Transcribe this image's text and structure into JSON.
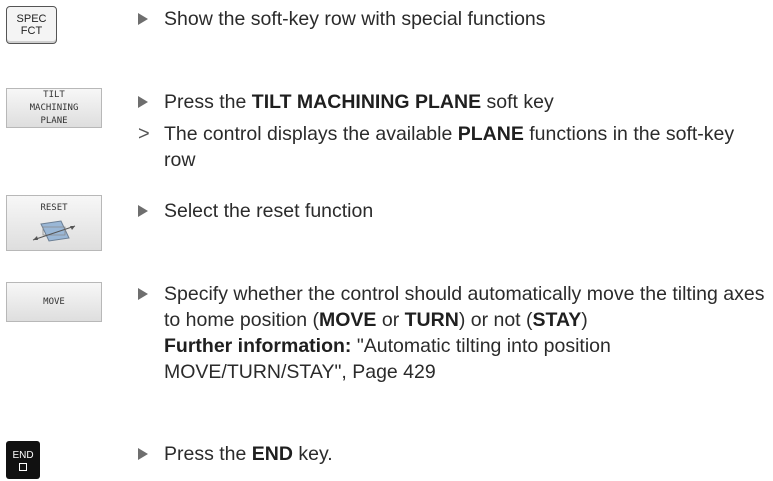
{
  "keys": {
    "spec_fct": "SPEC\nFCT",
    "tilt": "TILT\nMACHINING\nPLANE",
    "reset": "RESET",
    "move": "MOVE",
    "end": "END"
  },
  "steps": {
    "s1": "Show the soft-key row with special functions",
    "s2_pre": "Press the ",
    "s2_bold": "TILT MACHINING PLANE",
    "s2_post": " soft key",
    "s3_pre": "The control displays the available ",
    "s3_bold": "PLANE",
    "s3_post": " functions in the soft-key row",
    "s4": "Select the reset function",
    "s5_a": "Specify whether the control should automatically move the tilting axes to home position (",
    "s5_move": "MOVE",
    "s5_or": " or ",
    "s5_turn": "TURN",
    "s5_b": ") or not (",
    "s5_stay": "STAY",
    "s5_c": ")",
    "s5_info_label": "Further information:",
    "s5_info_text": " \"Automatic tilting into position MOVE/TURN/STAY\", Page 429",
    "s6_pre": "Press the ",
    "s6_bold": "END",
    "s6_post": " key."
  },
  "markers": {
    "action": "▶",
    "result": ">"
  }
}
